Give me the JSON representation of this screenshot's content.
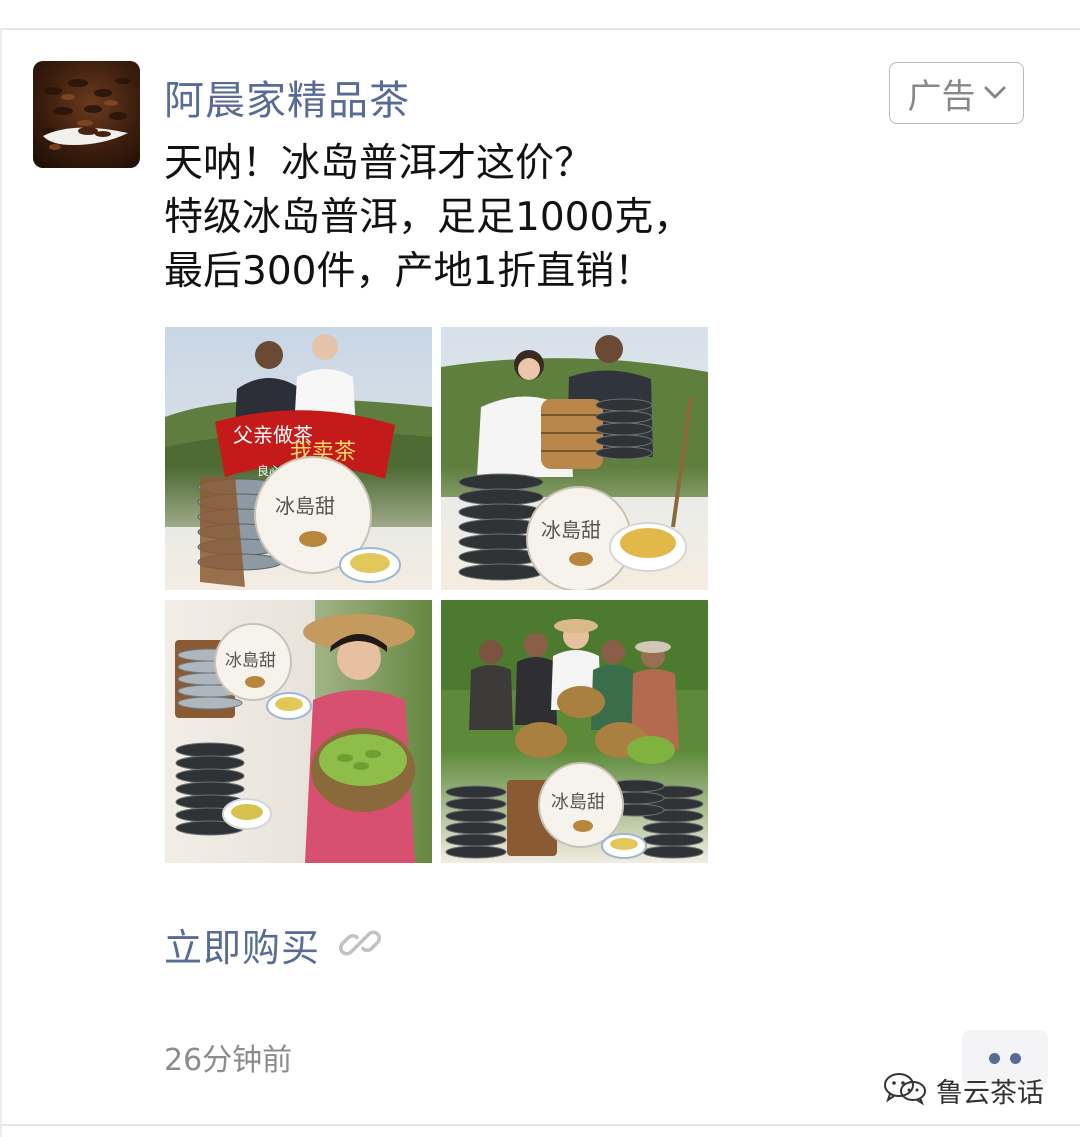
{
  "post": {
    "account_name": "阿晨家精品茶",
    "ad_label": "广告",
    "text_lines": [
      "天呐！冰岛普洱才这价？",
      "特级冰岛普洱，足足1000克，",
      "最后300件，产地1折直销！"
    ],
    "images": [
      {
        "banner_line1": "父亲做茶",
        "banner_line2": "我卖茶",
        "banner_line3": "良心茶 放心购",
        "cake_label": "冰島甜"
      },
      {
        "cake_label": "冰島甜"
      },
      {
        "cake_label": "冰島甜"
      },
      {
        "cake_label": "冰島甜"
      }
    ],
    "buy_label": "立即购买",
    "timestamp": "26分钟前"
  },
  "watermark": {
    "text": "鲁云茶话"
  },
  "colors": {
    "link": "#576b95",
    "text": "#111111",
    "muted": "#8c8c8c"
  },
  "icons": [
    "chevron-down-icon",
    "link-icon",
    "more-dots-icon",
    "wechat-icon"
  ]
}
